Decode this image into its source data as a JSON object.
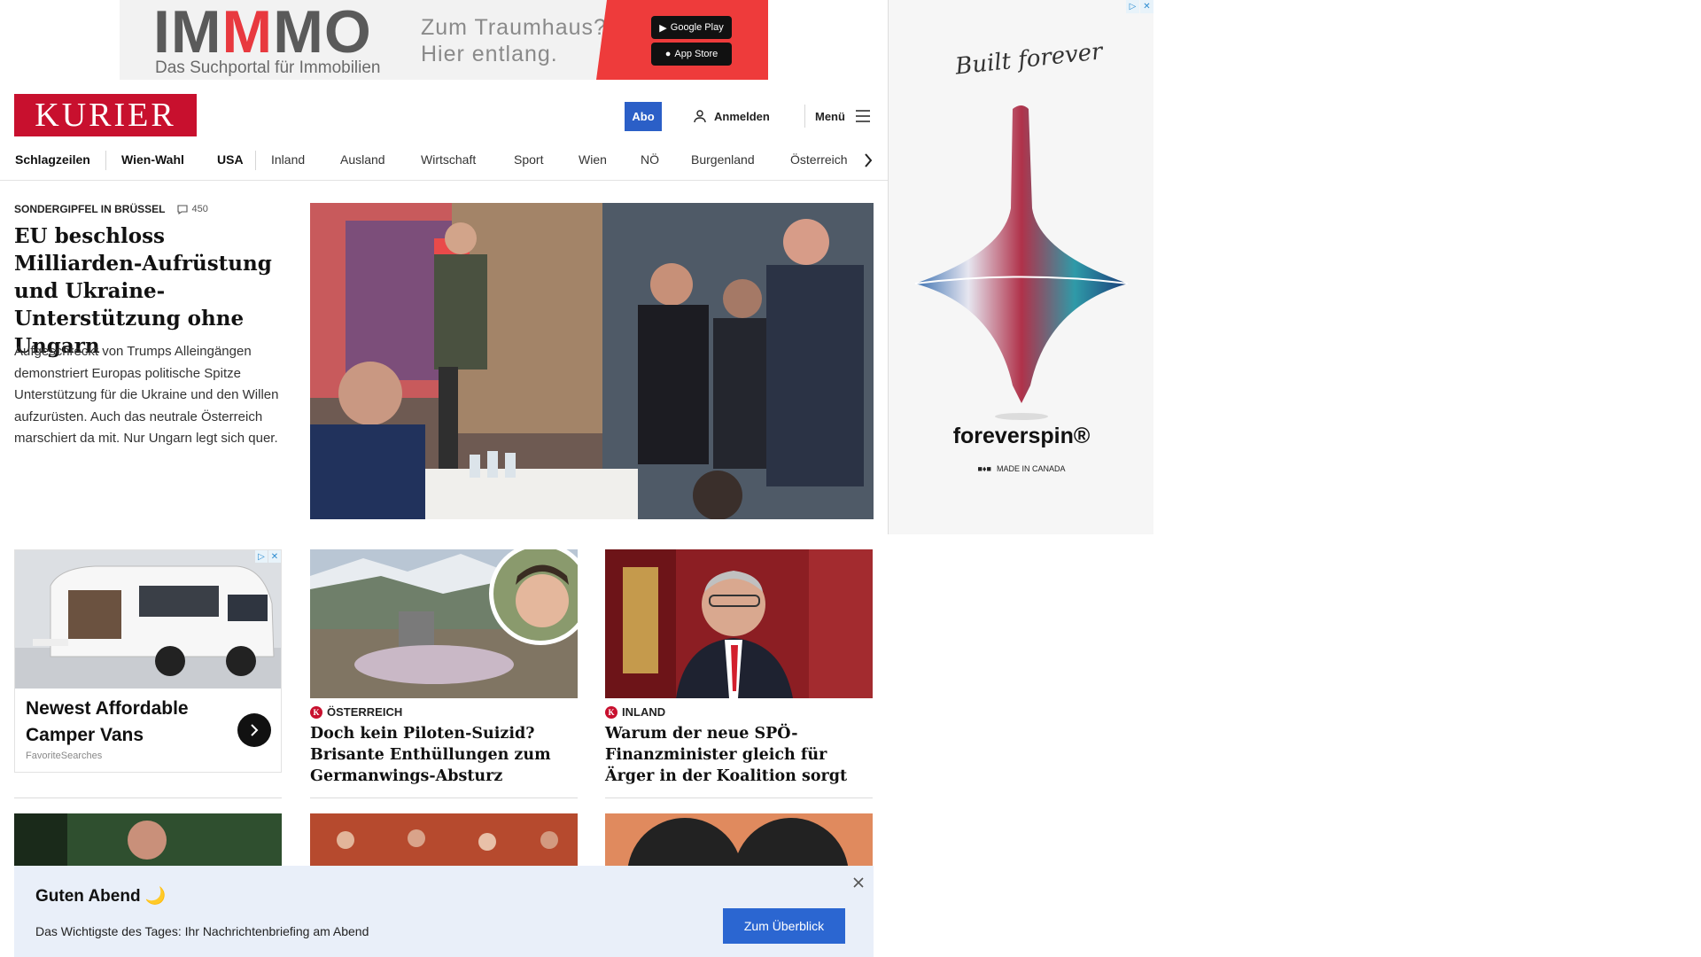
{
  "top_ad": {
    "brand_first": "IM",
    "brand_accent": "M",
    "brand_last": "MO",
    "tagline": "Das Suchportal für Immobilien",
    "claim": "Zum Traumhaus? Hier entlang.",
    "google_play": "Google Play",
    "app_store": "App Store"
  },
  "header": {
    "logo": "KURIER",
    "abo": "Abo",
    "login": "Anmelden",
    "menu": "Menü"
  },
  "nav": {
    "items": [
      "Schlagzeilen",
      "Wien-Wahl",
      "USA",
      "Inland",
      "Ausland",
      "Wirtschaft",
      "Sport",
      "Wien",
      "NÖ",
      "Burgenland",
      "Österreich"
    ]
  },
  "lead": {
    "kicker": "SONDERGIPFEL IN BRÜSSEL",
    "comments": "450",
    "title": "EU beschloss Milliarden-Aufrüstung und Ukraine-Unterstützung ohne Ungarn",
    "teaser": "Aufgeschreckt von Trumps Alleingängen demonstriert Europas politische Spitze Unterstützung für die Ukraine und den Willen aufzurüsten. Auch das neutrale Österreich marschiert da mit. Nur Ungarn legt sich quer."
  },
  "camper_ad": {
    "title": "Newest Affordable Camper Vans",
    "source": "FavoriteSearches"
  },
  "cards": [
    {
      "kicker": "ÖSTERREICH",
      "title": "Doch kein Piloten-Suizid? Brisante Enthüllungen zum Germanwings-Absturz"
    },
    {
      "kicker": "INLAND",
      "title": "Warum der neue SPÖ-Finanzminister gleich für Ärger in der Koalition sorgt"
    }
  ],
  "side_ad": {
    "script": "Built forever",
    "brand": "foreverspin®",
    "made": "MADE IN CANADA"
  },
  "briefing": {
    "title": "Guten Abend 🌙",
    "text": "Das Wichtigste des Tages: Ihr Nachrichtenbriefing am Abend",
    "cta": "Zum Überblick"
  },
  "colors": {
    "brand_red": "#c8102e",
    "abo_blue": "#2b5fc7",
    "briefing_bg": "#e9eff9"
  }
}
